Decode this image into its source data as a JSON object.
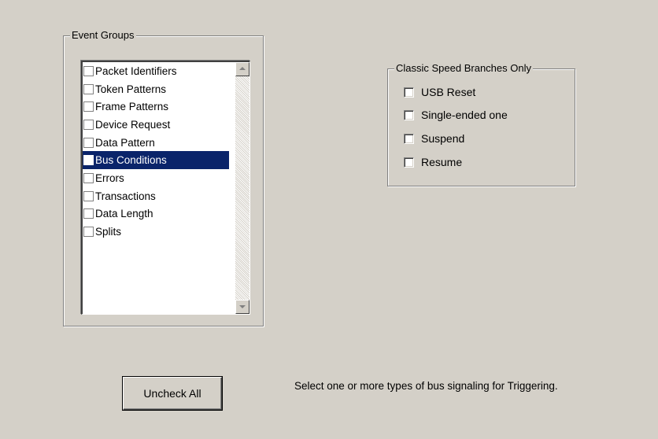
{
  "event_groups": {
    "title": "Event Groups",
    "items": [
      {
        "label": "Packet Identifiers",
        "checked": false,
        "selected": false
      },
      {
        "label": "Token Patterns",
        "checked": false,
        "selected": false
      },
      {
        "label": "Frame Patterns",
        "checked": false,
        "selected": false
      },
      {
        "label": "Device Request",
        "checked": false,
        "selected": false
      },
      {
        "label": "Data Pattern",
        "checked": false,
        "selected": false
      },
      {
        "label": "Bus Conditions",
        "checked": false,
        "selected": true
      },
      {
        "label": "Errors",
        "checked": false,
        "selected": false
      },
      {
        "label": "Transactions",
        "checked": false,
        "selected": false
      },
      {
        "label": "Data Length",
        "checked": false,
        "selected": false
      },
      {
        "label": "Splits",
        "checked": false,
        "selected": false
      }
    ]
  },
  "classic_speed": {
    "title": "Classic Speed Branches Only",
    "options": [
      {
        "label": "USB Reset",
        "checked": false
      },
      {
        "label": "Single-ended one",
        "checked": false
      },
      {
        "label": "Suspend",
        "checked": false
      },
      {
        "label": "Resume",
        "checked": false
      }
    ]
  },
  "actions": {
    "uncheck_all_label": "Uncheck All"
  },
  "hint_text": "Select one or more types of bus signaling for Triggering.",
  "colors": {
    "background": "#d4d0c8",
    "selection": "#0a246a"
  }
}
